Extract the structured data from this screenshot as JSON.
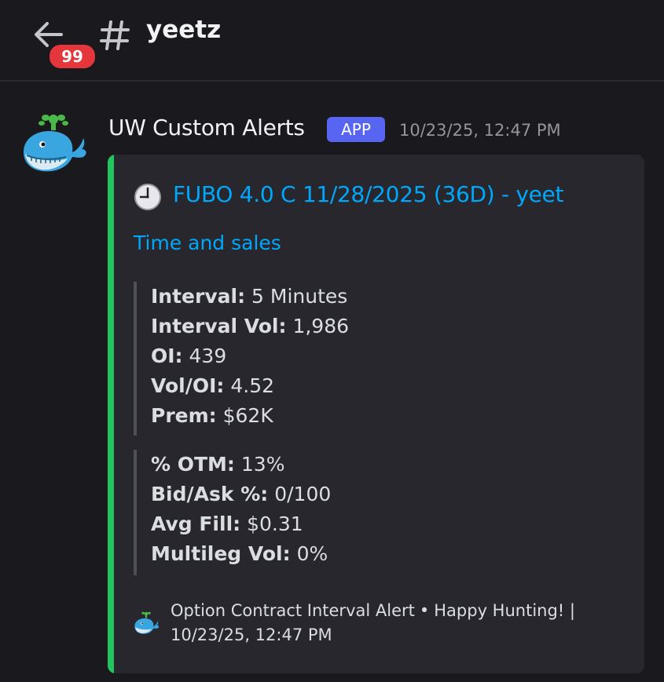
{
  "header": {
    "notification_count": "99",
    "channel_name": "yeetz"
  },
  "message": {
    "author": "UW Custom Alerts",
    "tag": "APP",
    "timestamp": "10/23/25, 12:47 PM",
    "embed": {
      "accent_color": "#23c55e",
      "title": "FUBO 4.0 C 11/28/2025 (36D) - yeet",
      "link": "Time and sales",
      "fields_group1": [
        {
          "label": "Interval:",
          "value": "5 Minutes"
        },
        {
          "label": "Interval Vol:",
          "value": "1,986"
        },
        {
          "label": "OI:",
          "value": "439"
        },
        {
          "label": "Vol/OI:",
          "value": "4.52"
        },
        {
          "label": "Prem:",
          "value": "$62K"
        }
      ],
      "fields_group2": [
        {
          "label": "% OTM:",
          "value": "13%"
        },
        {
          "label": "Bid/Ask %:",
          "value": "0/100"
        },
        {
          "label": "Avg Fill:",
          "value": "$0.31"
        },
        {
          "label": "Multileg Vol:",
          "value": "0%"
        }
      ],
      "footer": {
        "text": "Option Contract Interval Alert",
        "separator": "•",
        "extra": "Happy Hunting! |",
        "timestamp": "10/23/25, 12:47 PM"
      }
    }
  },
  "icons": {
    "back": "back-arrow-icon",
    "channel": "hash-icon",
    "avatar": "whale-icon",
    "title": "clock-icon"
  }
}
